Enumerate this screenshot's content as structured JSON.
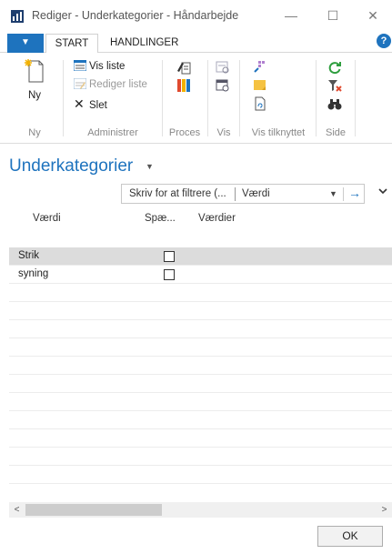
{
  "window": {
    "title": "Rediger - Underkategorier - Håndarbejde",
    "minimize_glyph": "—",
    "maximize_glyph": "☐",
    "close_glyph": "✕"
  },
  "ribbon": {
    "app_menu_glyph": "▼",
    "tabs": [
      "START",
      "HANDLINGER"
    ],
    "help_glyph": "?",
    "groups": {
      "ny": {
        "label": "Ny",
        "new_button": "Ny"
      },
      "administrer": {
        "label": "Administrer",
        "vis_liste": "Vis liste",
        "rediger_liste": "Rediger liste",
        "slet": "Slet",
        "slet_glyph": "✕"
      },
      "proces": {
        "label": "Proces"
      },
      "vis": {
        "label": "Vis"
      },
      "vis_tilknyttet": {
        "label": "Vis tilknyttet"
      },
      "side": {
        "label": "Side"
      }
    }
  },
  "page": {
    "title": "Underkategorier",
    "title_caret": "▼",
    "filter": {
      "placeholder": "Skriv for at filtrere (...",
      "field": "Værdi",
      "dropdown_glyph": "▼",
      "go_glyph": "→"
    },
    "collapse_glyph": "⌄",
    "columns": [
      "Værdi",
      "Spæ...",
      "Værdier"
    ],
    "rows": [
      {
        "vaerdi": "Strik",
        "spaerret": false,
        "selected": true
      },
      {
        "vaerdi": "syning",
        "spaerret": false,
        "selected": false
      }
    ],
    "scroll_left_glyph": "<",
    "scroll_right_glyph": ">",
    "ok_label": "OK"
  },
  "colors": {
    "accent": "#1e73be",
    "selected_row": "#dcdcdc",
    "disabled_text": "#999999"
  }
}
